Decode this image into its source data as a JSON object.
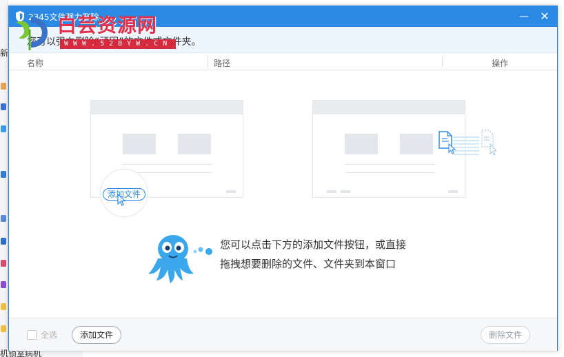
{
  "window": {
    "title": "2345文件强力删除",
    "minimize_glyph": "—",
    "close_glyph": "✕"
  },
  "watermark": {
    "title": "白芸资源网",
    "url": "WWW.52BYW.CN"
  },
  "hint": {
    "text": "您可以强力删除“顽固”的文件或文件夹。"
  },
  "table": {
    "columns": [
      "名称",
      "路径",
      "操作"
    ]
  },
  "illustration": {
    "add_file_label": "添加文件"
  },
  "help": {
    "line1": "您可以点击下方的添加文件按钮，或直接",
    "line2": "拖拽想要删除的文件、文件夹到本窗口"
  },
  "footer": {
    "select_all_label": "全选",
    "add_file_label": "添加文件",
    "delete_file_label": "删除文件"
  },
  "background": {
    "new_label": "新",
    "caption": "机锁室病机"
  },
  "colors": {
    "accent": "#2b8ae6",
    "hint_bg": "#eef6fd",
    "watermark_red": "#e2304a"
  }
}
